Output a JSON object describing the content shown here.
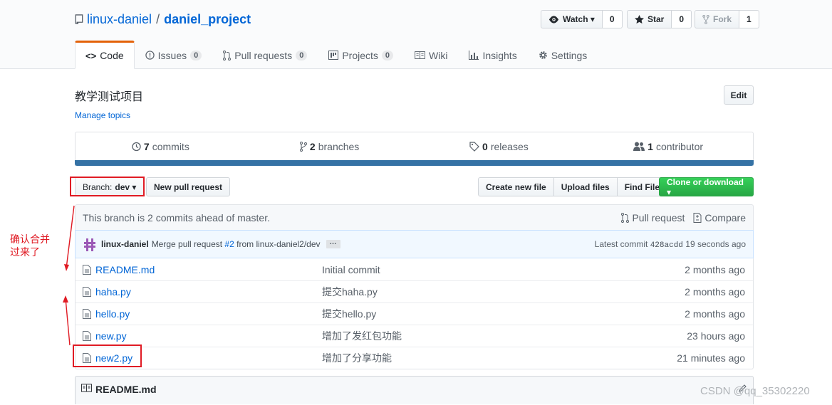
{
  "repo": {
    "owner": "linux-daniel",
    "separator": "/",
    "name": "daniel_project"
  },
  "actions": {
    "watch": {
      "label": "Watch ▾",
      "count": "0"
    },
    "star": {
      "label": "Star",
      "count": "0"
    },
    "fork": {
      "label": "Fork",
      "count": "1"
    }
  },
  "tabs": [
    {
      "label": "Code"
    },
    {
      "label": "Issues",
      "count": "0"
    },
    {
      "label": "Pull requests",
      "count": "0"
    },
    {
      "label": "Projects",
      "count": "0"
    },
    {
      "label": "Wiki"
    },
    {
      "label": "Insights"
    },
    {
      "label": "Settings"
    }
  ],
  "description": "教学测试项目",
  "manage_topics": "Manage topics",
  "edit_label": "Edit",
  "numbers": {
    "commits_count": "7",
    "commits_label": "commits",
    "branches_count": "2",
    "branches_label": "branches",
    "releases_count": "0",
    "releases_label": "releases",
    "contributors_count": "1",
    "contributors_label": "contributor"
  },
  "file_nav": {
    "branch_prefix": "Branch:",
    "branch_name": "dev ▾",
    "new_pr": "New pull request",
    "create_file": "Create new file",
    "upload": "Upload files",
    "find": "Find File",
    "clone": "Clone or download ▾"
  },
  "branch_status": {
    "text": "This branch is 2 commits ahead of master.",
    "pull_request": "Pull request",
    "compare": "Compare"
  },
  "commit_tease": {
    "author": "linux-daniel",
    "message_prefix": "Merge pull request",
    "pr_link": "#2",
    "message_suffix": "from linux-daniel2/dev",
    "ellipsis": "…",
    "latest_label": "Latest commit",
    "sha": "428acdd",
    "age": "19 seconds ago"
  },
  "files": [
    {
      "name": "README.md",
      "message": "Initial commit",
      "age": "2 months ago"
    },
    {
      "name": "haha.py",
      "message": "提交haha.py",
      "age": "2 months ago"
    },
    {
      "name": "hello.py",
      "message": "提交hello.py",
      "age": "2 months ago"
    },
    {
      "name": "new.py",
      "message": "增加了发红包功能",
      "age": "23 hours ago"
    },
    {
      "name": "new2.py",
      "message": "增加了分享功能",
      "age": "21 minutes ago"
    }
  ],
  "readme_header": "README.md",
  "annotation": {
    "line1": "确认合并",
    "line2": "过来了"
  },
  "watermark": "CSDN @qq_35302220",
  "colors": {
    "accent": "#0366d6",
    "annotation_red": "#e01b24",
    "clone_green": "#28a745",
    "language_bar": "#3572A5",
    "selected_tab_top": "#e36209"
  }
}
